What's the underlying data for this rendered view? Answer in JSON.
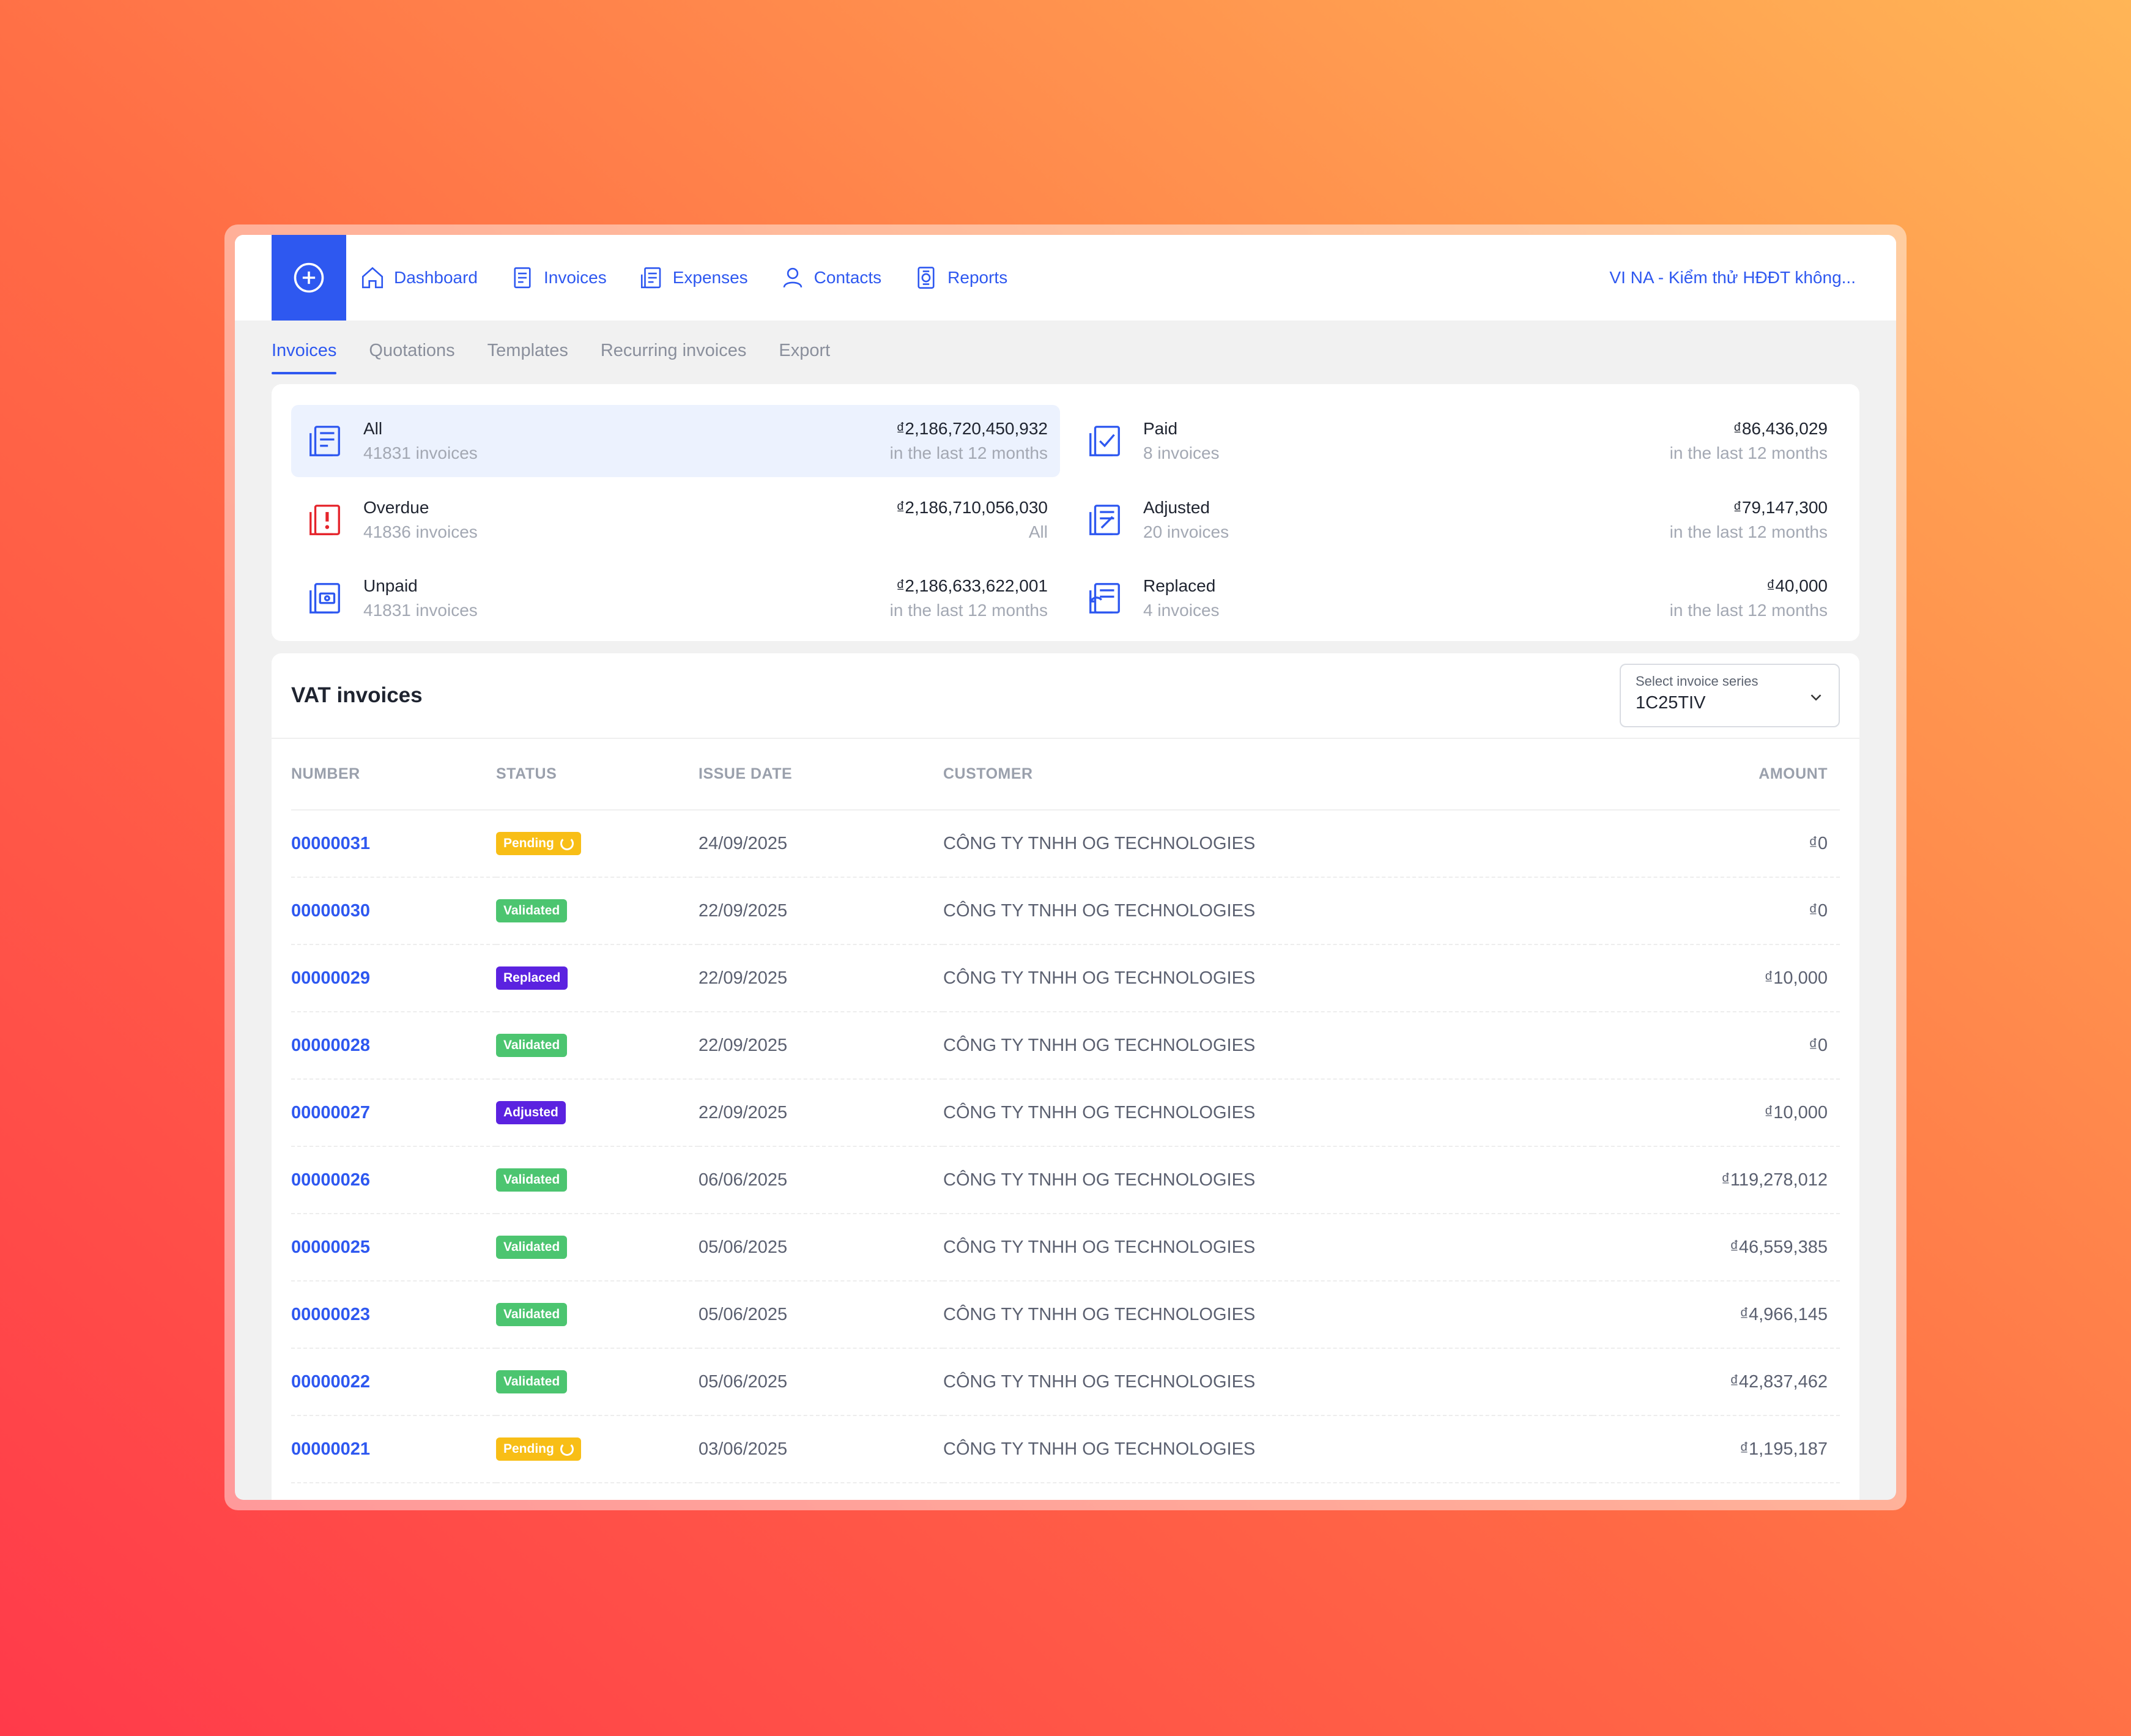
{
  "nav": {
    "items": [
      {
        "label": "Dashboard",
        "icon": "home-icon"
      },
      {
        "label": "Invoices",
        "icon": "invoice-icon"
      },
      {
        "label": "Expenses",
        "icon": "expense-icon"
      },
      {
        "label": "Contacts",
        "icon": "user-icon"
      },
      {
        "label": "Reports",
        "icon": "report-icon"
      }
    ],
    "org_name": "VI NA - Kiểm thử HĐĐT không..."
  },
  "subtabs": [
    {
      "label": "Invoices"
    },
    {
      "label": "Quotations"
    },
    {
      "label": "Templates"
    },
    {
      "label": "Recurring invoices"
    },
    {
      "label": "Export"
    }
  ],
  "summary": {
    "all": {
      "label": "All",
      "count": "41831 invoices",
      "amount": "₫2,186,720,450,932",
      "period": "in the last 12 months"
    },
    "paid": {
      "label": "Paid",
      "count": "8 invoices",
      "amount": "₫86,436,029",
      "period": "in the last 12 months"
    },
    "overdue": {
      "label": "Overdue",
      "count": "41836 invoices",
      "amount": "₫2,186,710,056,030",
      "period": "All"
    },
    "adjusted": {
      "label": "Adjusted",
      "count": "20 invoices",
      "amount": "₫79,147,300",
      "period": "in the last 12 months"
    },
    "unpaid": {
      "label": "Unpaid",
      "count": "41831 invoices",
      "amount": "₫2,186,633,622,001",
      "period": "in the last 12 months"
    },
    "replaced": {
      "label": "Replaced",
      "count": "4 invoices",
      "amount": "₫40,000",
      "period": "in the last 12 months"
    }
  },
  "table": {
    "title": "VAT invoices",
    "series_select": {
      "caption": "Select invoice series",
      "value": "1C25TIV"
    },
    "columns": {
      "number": "NUMBER",
      "status": "STATUS",
      "issue_date": "ISSUE DATE",
      "customer": "CUSTOMER",
      "amount": "AMOUNT"
    },
    "rows": [
      {
        "number": "00000031",
        "status": "Pending",
        "date": "24/09/2025",
        "customer": "CÔNG TY TNHH OG TECHNOLOGIES",
        "amount": "₫0"
      },
      {
        "number": "00000030",
        "status": "Validated",
        "date": "22/09/2025",
        "customer": "CÔNG TY TNHH OG TECHNOLOGIES",
        "amount": "₫0"
      },
      {
        "number": "00000029",
        "status": "Replaced",
        "date": "22/09/2025",
        "customer": "CÔNG TY TNHH OG TECHNOLOGIES",
        "amount": "₫10,000"
      },
      {
        "number": "00000028",
        "status": "Validated",
        "date": "22/09/2025",
        "customer": "CÔNG TY TNHH OG TECHNOLOGIES",
        "amount": "₫0"
      },
      {
        "number": "00000027",
        "status": "Adjusted",
        "date": "22/09/2025",
        "customer": "CÔNG TY TNHH OG TECHNOLOGIES",
        "amount": "₫10,000"
      },
      {
        "number": "00000026",
        "status": "Validated",
        "date": "06/06/2025",
        "customer": "CÔNG TY TNHH OG TECHNOLOGIES",
        "amount": "₫119,278,012"
      },
      {
        "number": "00000025",
        "status": "Validated",
        "date": "05/06/2025",
        "customer": "CÔNG TY TNHH OG TECHNOLOGIES",
        "amount": "₫46,559,385"
      },
      {
        "number": "00000023",
        "status": "Validated",
        "date": "05/06/2025",
        "customer": "CÔNG TY TNHH OG TECHNOLOGIES",
        "amount": "₫4,966,145"
      },
      {
        "number": "00000022",
        "status": "Validated",
        "date": "05/06/2025",
        "customer": "CÔNG TY TNHH OG TECHNOLOGIES",
        "amount": "₫42,837,462"
      },
      {
        "number": "00000021",
        "status": "Pending",
        "date": "03/06/2025",
        "customer": "CÔNG TY TNHH OG TECHNOLOGIES",
        "amount": "₫1,195,187"
      }
    ]
  },
  "colors": {
    "accent": "#2e58f0",
    "pending": "#f8be16",
    "validated": "#4cc570",
    "replaced": "#5b22e0",
    "overdue": "#e5242b"
  }
}
